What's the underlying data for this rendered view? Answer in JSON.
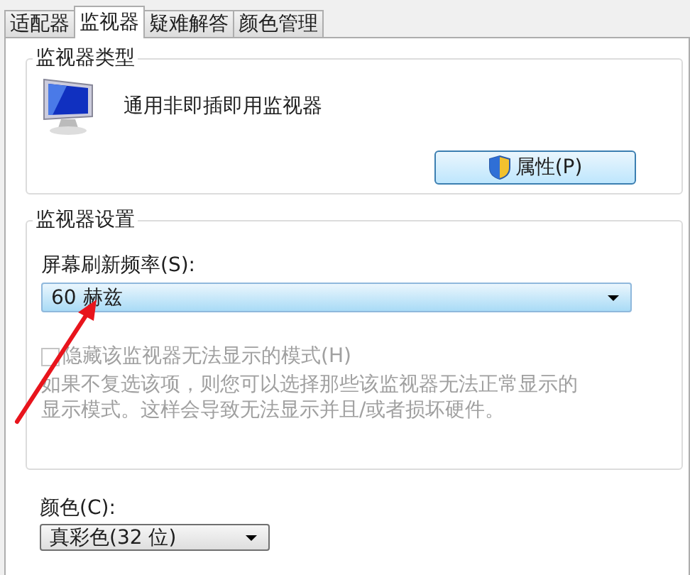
{
  "tabs": [
    {
      "label": "适配器",
      "selected": false
    },
    {
      "label": "监视器",
      "selected": true
    },
    {
      "label": "疑难解答",
      "selected": false
    },
    {
      "label": "颜色管理",
      "selected": false
    }
  ],
  "monitor_type": {
    "title": "监视器类型",
    "name": "通用非即插即用监视器",
    "button": "属性(P)"
  },
  "monitor_settings": {
    "title": "监视器设置",
    "refresh_label": "屏幕刷新频率(S):",
    "refresh_value": "60 赫兹",
    "hide_modes": {
      "label": "隐藏该监视器无法显示的模式(H)",
      "checked": false,
      "disabled": true
    },
    "description": "如果不复选该项，则您可以选择那些该监视器无法正常显示的显示模式。这样会导致无法显示并且/或者损坏硬件。"
  },
  "color": {
    "label": "颜色(C):",
    "value": "真彩色(32 位)"
  }
}
